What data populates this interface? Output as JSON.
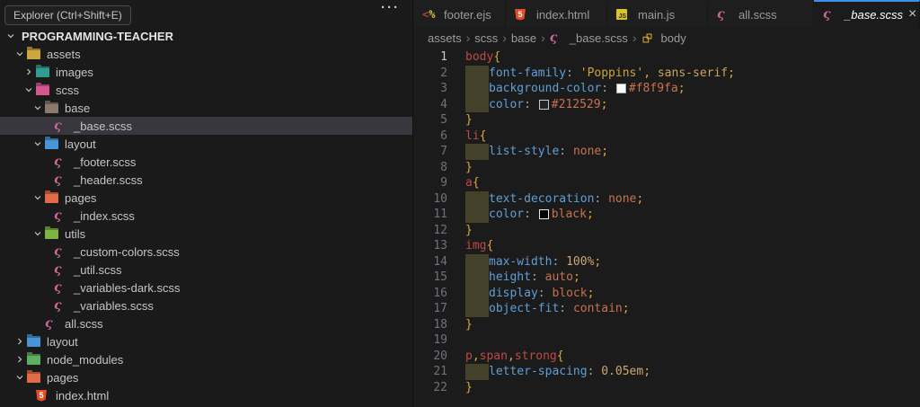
{
  "colors": {
    "accent_blue": "#3b8eea",
    "sass_pink": "#cd6799",
    "html_orange": "#e44d26",
    "js_yellow": "#d7c52e",
    "selection_bg": "#37373d",
    "indent_highlight": "#44412a",
    "swatch_values": {
      "background": "#f8f9fa",
      "text": "#212529",
      "link": "black"
    }
  },
  "sidebar": {
    "tooltip": "Explorer (Ctrl+Shift+E)",
    "more_label": "···",
    "root": "PROGRAMMING-TEACHER",
    "tree": [
      {
        "label": "assets",
        "kind": "folder",
        "depth": 1,
        "chev": "down",
        "folder_color": "#cea63e"
      },
      {
        "label": "images",
        "kind": "folder",
        "depth": 2,
        "chev": "right",
        "folder_color": "#2f9c8f"
      },
      {
        "label": "scss",
        "kind": "folder",
        "depth": 2,
        "chev": "down",
        "folder_color": "#d4578f"
      },
      {
        "label": "base",
        "kind": "folder",
        "depth": 3,
        "chev": "down",
        "folder_color": "#8a7a6c"
      },
      {
        "label": "_base.scss",
        "kind": "file",
        "depth": 4,
        "icon": "sass",
        "selected": true
      },
      {
        "label": "layout",
        "kind": "folder",
        "depth": 3,
        "chev": "down",
        "folder_color": "#4596d8"
      },
      {
        "label": "_footer.scss",
        "kind": "file",
        "depth": 4,
        "icon": "sass"
      },
      {
        "label": "_header.scss",
        "kind": "file",
        "depth": 4,
        "icon": "sass"
      },
      {
        "label": "pages",
        "kind": "folder",
        "depth": 3,
        "chev": "down",
        "folder_color": "#e06c47"
      },
      {
        "label": "_index.scss",
        "kind": "file",
        "depth": 4,
        "icon": "sass"
      },
      {
        "label": "utils",
        "kind": "folder",
        "depth": 3,
        "chev": "down",
        "folder_color": "#7cb342"
      },
      {
        "label": "_custom-colors.scss",
        "kind": "file",
        "depth": 4,
        "icon": "sass"
      },
      {
        "label": "_util.scss",
        "kind": "file",
        "depth": 4,
        "icon": "sass"
      },
      {
        "label": "_variables-dark.scss",
        "kind": "file",
        "depth": 4,
        "icon": "sass"
      },
      {
        "label": "_variables.scss",
        "kind": "file",
        "depth": 4,
        "icon": "sass"
      },
      {
        "label": "all.scss",
        "kind": "file",
        "depth": 3,
        "icon": "sass"
      },
      {
        "label": "layout",
        "kind": "folder",
        "depth": 1,
        "chev": "right",
        "folder_color": "#4596d8"
      },
      {
        "label": "node_modules",
        "kind": "folder",
        "depth": 1,
        "chev": "right",
        "folder_color": "#5fad5f"
      },
      {
        "label": "pages",
        "kind": "folder",
        "depth": 1,
        "chev": "down",
        "folder_color": "#e06c47"
      },
      {
        "label": "index.html",
        "kind": "file",
        "depth": 2,
        "icon": "html"
      }
    ]
  },
  "tabs": [
    {
      "label": "footer.ejs",
      "icon": "ejs",
      "active": false
    },
    {
      "label": "index.html",
      "icon": "html",
      "active": false
    },
    {
      "label": "main.js",
      "icon": "js",
      "active": false
    },
    {
      "label": "all.scss",
      "icon": "sass",
      "active": false
    },
    {
      "label": "_base.scss",
      "icon": "sass",
      "active": true,
      "close_label": "×"
    }
  ],
  "breadcrumb": [
    {
      "label": "assets"
    },
    {
      "label": "scss"
    },
    {
      "label": "base"
    },
    {
      "label": "_base.scss",
      "icon": "sass"
    },
    {
      "label": "body",
      "icon": "symbol"
    }
  ],
  "editor": {
    "lines": [
      {
        "n": 1,
        "active": true,
        "ind": false,
        "tk": [
          [
            "sel",
            "body"
          ],
          [
            "brc",
            "{"
          ]
        ]
      },
      {
        "n": 2,
        "ind": true,
        "tk": [
          [
            "prp",
            "font-family"
          ],
          [
            "col",
            ": "
          ],
          [
            "str",
            "'Poppins'"
          ],
          [
            "pun",
            ", "
          ],
          [
            "v2",
            "sans-serif"
          ],
          [
            "smc",
            ";"
          ]
        ]
      },
      {
        "n": 3,
        "ind": true,
        "tk": [
          [
            "prp",
            "background-color"
          ],
          [
            "col",
            ": "
          ],
          [
            "swW",
            ""
          ],
          [
            "val",
            "#f8f9fa"
          ],
          [
            "smc",
            ";"
          ]
        ]
      },
      {
        "n": 4,
        "ind": true,
        "tk": [
          [
            "prp",
            "color"
          ],
          [
            "col",
            ": "
          ],
          [
            "swD",
            ""
          ],
          [
            "val",
            "#212529"
          ],
          [
            "smc",
            ";"
          ]
        ]
      },
      {
        "n": 5,
        "ind": false,
        "tk": [
          [
            "brc",
            "}"
          ]
        ]
      },
      {
        "n": 6,
        "ind": false,
        "tk": [
          [
            "sel",
            "li"
          ],
          [
            "brc",
            "{"
          ]
        ]
      },
      {
        "n": 7,
        "ind": true,
        "tk": [
          [
            "prp",
            "list-style"
          ],
          [
            "col",
            ": "
          ],
          [
            "val",
            "none"
          ],
          [
            "smc",
            ";"
          ]
        ]
      },
      {
        "n": 8,
        "ind": false,
        "tk": [
          [
            "brc",
            "}"
          ]
        ]
      },
      {
        "n": 9,
        "ind": false,
        "tk": [
          [
            "sel",
            "a"
          ],
          [
            "brc",
            "{"
          ]
        ]
      },
      {
        "n": 10,
        "ind": true,
        "tk": [
          [
            "prp",
            "text-decoration"
          ],
          [
            "col",
            ": "
          ],
          [
            "val",
            "none"
          ],
          [
            "smc",
            ";"
          ]
        ]
      },
      {
        "n": 11,
        "ind": true,
        "tk": [
          [
            "prp",
            "color"
          ],
          [
            "col",
            ": "
          ],
          [
            "swB",
            ""
          ],
          [
            "val",
            "black"
          ],
          [
            "smc",
            ";"
          ]
        ]
      },
      {
        "n": 12,
        "ind": false,
        "tk": [
          [
            "brc",
            "}"
          ]
        ]
      },
      {
        "n": 13,
        "ind": false,
        "tk": [
          [
            "sel",
            "img"
          ],
          [
            "brc",
            "{"
          ]
        ]
      },
      {
        "n": 14,
        "ind": true,
        "tk": [
          [
            "prp",
            "max-width"
          ],
          [
            "col",
            ": "
          ],
          [
            "num",
            "100%"
          ],
          [
            "smc",
            ";"
          ]
        ]
      },
      {
        "n": 15,
        "ind": true,
        "tk": [
          [
            "prp",
            "height"
          ],
          [
            "col",
            ": "
          ],
          [
            "val",
            "auto"
          ],
          [
            "smc",
            ";"
          ]
        ]
      },
      {
        "n": 16,
        "ind": true,
        "tk": [
          [
            "prp",
            "display"
          ],
          [
            "col",
            ": "
          ],
          [
            "val",
            "block"
          ],
          [
            "smc",
            ";"
          ]
        ]
      },
      {
        "n": 17,
        "ind": true,
        "tk": [
          [
            "prp",
            "object-fit"
          ],
          [
            "col",
            ": "
          ],
          [
            "val",
            "contain"
          ],
          [
            "smc",
            ";"
          ]
        ]
      },
      {
        "n": 18,
        "ind": false,
        "tk": [
          [
            "brc",
            "}"
          ]
        ]
      },
      {
        "n": 19,
        "ind": false,
        "tk": []
      },
      {
        "n": 20,
        "ind": false,
        "tk": [
          [
            "sel",
            "p"
          ],
          [
            "pun",
            ","
          ],
          [
            "sel",
            "span"
          ],
          [
            "pun",
            ","
          ],
          [
            "sel",
            "strong"
          ],
          [
            "brc",
            "{"
          ]
        ]
      },
      {
        "n": 21,
        "ind": true,
        "tk": [
          [
            "prp",
            "letter-spacing"
          ],
          [
            "col",
            ": "
          ],
          [
            "num",
            "0.05em"
          ],
          [
            "smc",
            ";"
          ]
        ]
      },
      {
        "n": 22,
        "ind": false,
        "tk": [
          [
            "brc",
            "}"
          ]
        ]
      }
    ]
  }
}
